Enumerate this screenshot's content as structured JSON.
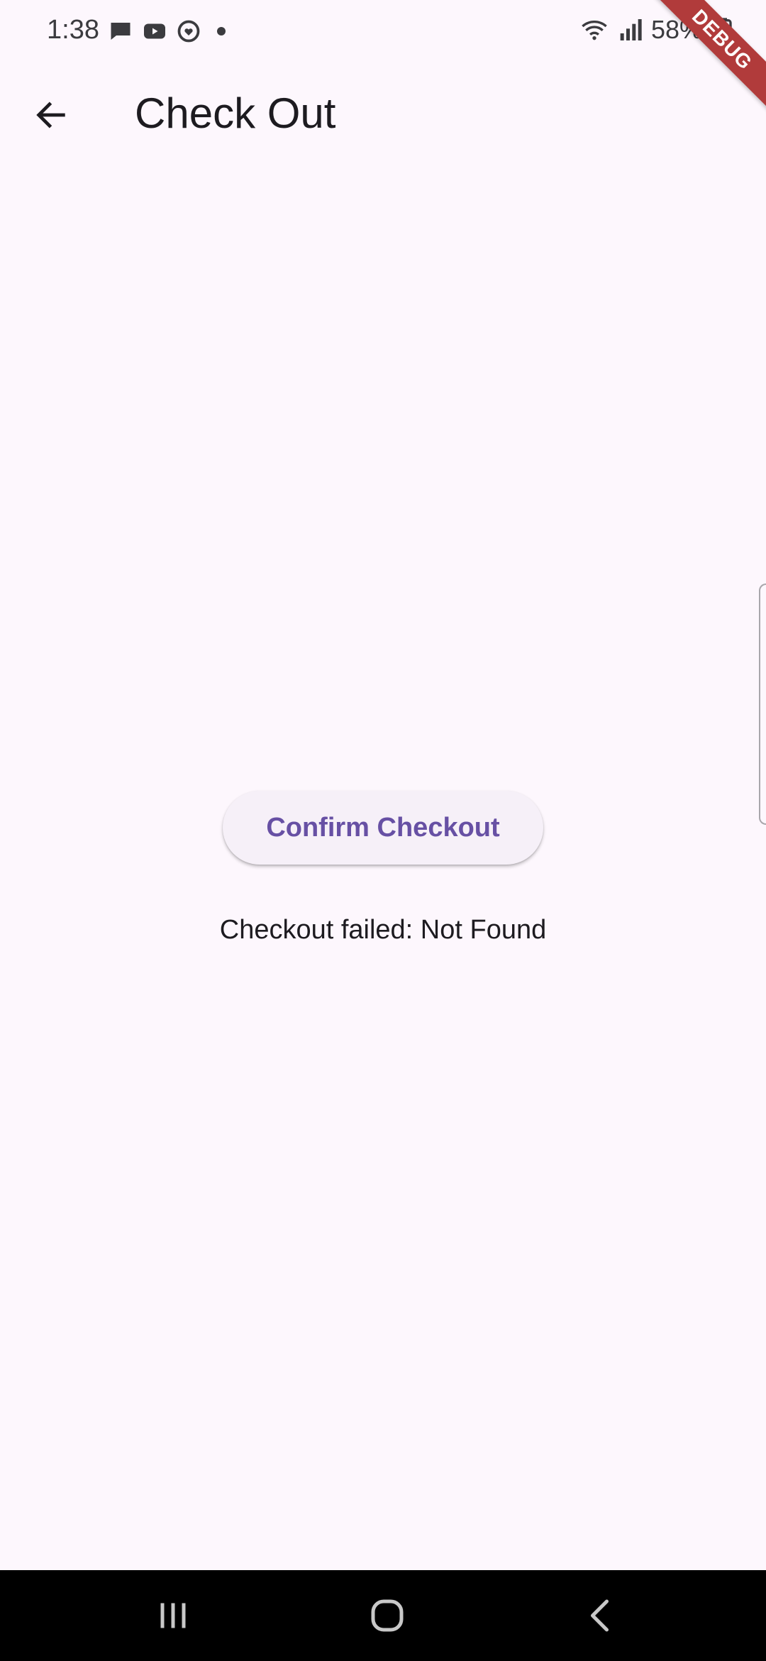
{
  "status_bar": {
    "time": "1:38",
    "left_icons": [
      "chat-icon",
      "youtube-icon",
      "podcast-icon"
    ],
    "right_icons": [
      "wifi-icon",
      "signal-icon",
      "battery-icon"
    ],
    "battery": "58%"
  },
  "debug_banner": {
    "label": "DEBUG"
  },
  "app_bar": {
    "back_icon": "arrow-back-icon",
    "title": "Check Out"
  },
  "main": {
    "confirm_button_label": "Confirm Checkout",
    "status_message": "Checkout failed: Not Found"
  },
  "nav_bar": {
    "icons": [
      "recents-icon",
      "home-icon",
      "back-icon"
    ]
  },
  "colors": {
    "background": "#fdf7fd",
    "accent": "#6750a4",
    "button_surface": "#f6f0f8",
    "debug_banner": "#b13b3b",
    "nav_bar": "#000000"
  }
}
